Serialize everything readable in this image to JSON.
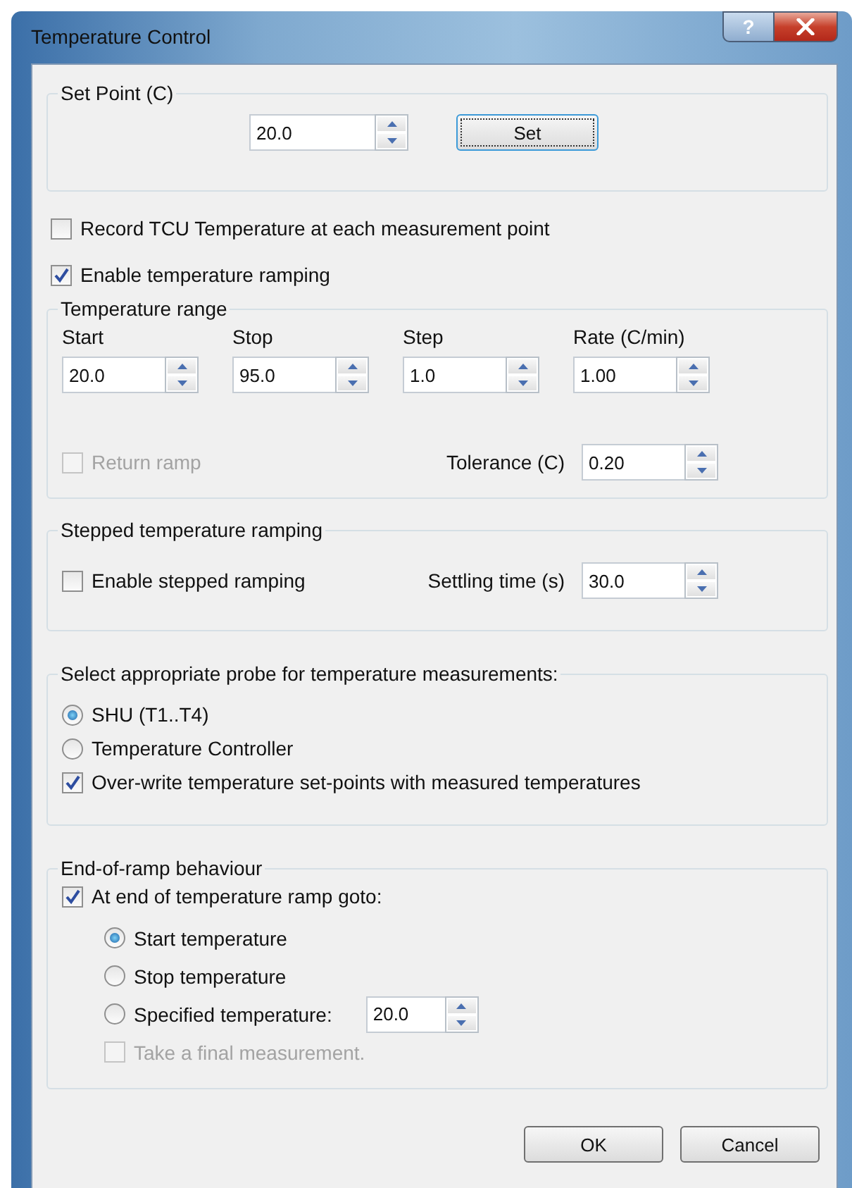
{
  "window": {
    "title": "Temperature Control",
    "help": "?"
  },
  "set_point": {
    "title": "Set Point (C)",
    "value": "20.0",
    "button": "Set"
  },
  "options": [
    {
      "label": "Record TCU Temperature at each measurement point",
      "checked": false
    },
    {
      "label": "Enable temperature ramping",
      "checked": true
    }
  ],
  "temperature_range": {
    "title": "Temperature range",
    "fields": [
      {
        "label": "Start",
        "value": "20.0"
      },
      {
        "label": "Stop",
        "value": "95.0"
      },
      {
        "label": "Step",
        "value": "1.0"
      },
      {
        "label": "Rate (C/min)",
        "value": "1.00"
      }
    ],
    "return_ramp": {
      "label": "Return ramp",
      "checked": false,
      "disabled": true
    },
    "tolerance": {
      "label": "Tolerance (C)",
      "value": "0.20"
    }
  },
  "stepped": {
    "title": "Stepped temperature ramping",
    "checkbox": {
      "label": "Enable stepped ramping",
      "checked": false
    },
    "settling": {
      "label": "Settling time (s)",
      "value": "30.0"
    }
  },
  "probe": {
    "title": "Select appropriate probe for temperature measurements:",
    "radios": [
      {
        "label": "SHU (T1..T4)",
        "selected": true
      },
      {
        "label": "Temperature Controller",
        "selected": false
      }
    ],
    "overwrite": {
      "label": "Over-write temperature set-points with measured temperatures",
      "checked": true
    }
  },
  "end_of_ramp": {
    "title": "End-of-ramp behaviour",
    "goto": {
      "label": "At end of temperature ramp goto:",
      "checked": true
    },
    "radios": [
      {
        "label": "Start temperature",
        "selected": true
      },
      {
        "label": "Stop temperature",
        "selected": false
      },
      {
        "label": "Specified temperature:",
        "selected": false,
        "value": "20.0"
      }
    ],
    "final": {
      "label": "Take a final measurement.",
      "checked": false,
      "disabled": true
    }
  },
  "buttons": [
    "OK",
    "Cancel"
  ]
}
